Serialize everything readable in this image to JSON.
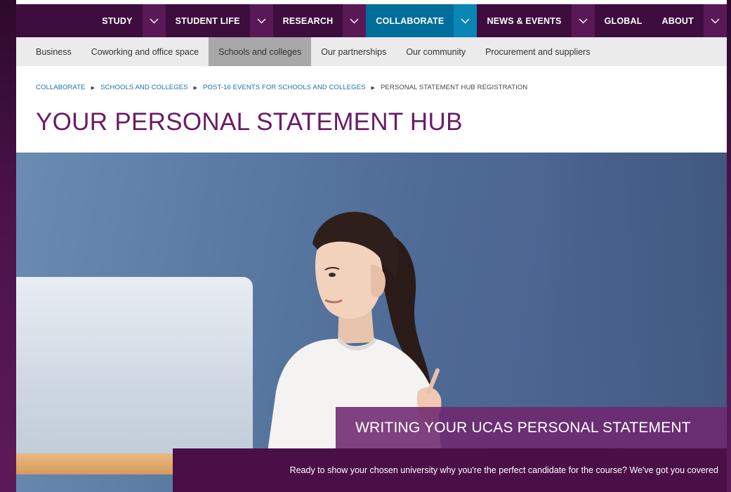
{
  "topnav": {
    "items": [
      {
        "label": "STUDY",
        "active": false
      },
      {
        "label": "STUDENT LIFE",
        "active": false
      },
      {
        "label": "RESEARCH",
        "active": false
      },
      {
        "label": "COLLABORATE",
        "active": true
      },
      {
        "label": "NEWS & EVENTS",
        "active": false
      },
      {
        "label": "GLOBAL",
        "active": false
      },
      {
        "label": "ABOUT",
        "active": false
      }
    ],
    "dropdown_icon": "chevron-down-icon"
  },
  "subnav": {
    "items": [
      {
        "label": "Business",
        "active": false
      },
      {
        "label": "Coworking and office space",
        "active": false
      },
      {
        "label": "Schools and colleges",
        "active": true
      },
      {
        "label": "Our partnerships",
        "active": false
      },
      {
        "label": "Our community",
        "active": false
      },
      {
        "label": "Procurement and suppliers",
        "active": false
      }
    ]
  },
  "breadcrumb": {
    "items": [
      {
        "label": "COLLABORATE"
      },
      {
        "label": "SCHOOLS AND COLLEGES"
      },
      {
        "label": "POST-16 EVENTS FOR SCHOOLS AND COLLEGES"
      },
      {
        "label": "PERSONAL STATEMENT HUB REGISTRATION"
      }
    ],
    "separator_icon": "triangle-right-icon"
  },
  "page": {
    "title": "YOUR PERSONAL STATEMENT HUB"
  },
  "hero": {
    "caption_title": "WRITING YOUR UCAS PERSONAL STATEMENT",
    "caption_text": "Ready to show your chosen university why you're the perfect candidate for the course? We've got you covered"
  },
  "colors": {
    "nav_bg": "#3d0d3d",
    "nav_chevron_bg": "#5b1857",
    "active_blue": "#006e9a",
    "title_purple": "#6a1c66",
    "link_blue": "#1b6fa5",
    "caption_dark": "#4b0f48"
  }
}
